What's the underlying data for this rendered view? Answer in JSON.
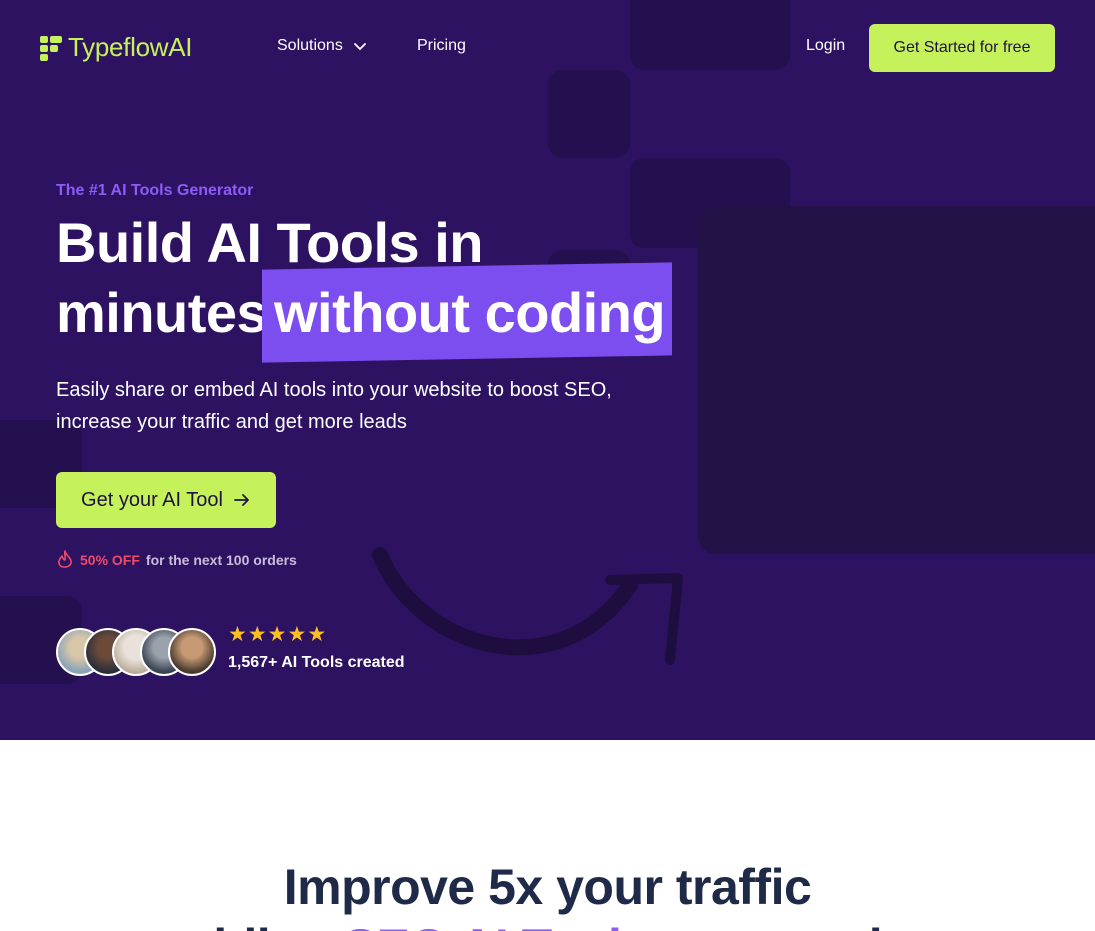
{
  "brand": {
    "name": "TypeflowAI",
    "accent": "#c5f15a",
    "hero_bg": "#2e1262",
    "highlight": "#7c4ef0"
  },
  "nav": {
    "solutions": "Solutions",
    "pricing": "Pricing",
    "login": "Login",
    "cta": "Get Started for free"
  },
  "hero": {
    "eyebrow": "The #1 AI Tools Generator",
    "title_line1": "Build AI Tools in",
    "title_line2_plain": "minutes",
    "title_line2_highlight": "without coding",
    "subtitle": "Easily share or embed AI tools into your website to boost SEO, increase your traffic and get more leads",
    "cta": "Get your AI Tool",
    "offer_highlight": "50% OFF",
    "offer_rest": "for the next 100 orders",
    "rating_stars": 5,
    "tools_created": "1,567+ AI Tools created"
  },
  "section": {
    "title_line1": "Improve 5x your traffic",
    "title_line2_pre": "adding",
    "title_line2_highlight": "SEO AI Tools",
    "title_line2_post": "to your site"
  },
  "icons": [
    "logo-icon",
    "chevron-down-icon",
    "arrow-right-icon",
    "flame-icon",
    "star-icon"
  ]
}
